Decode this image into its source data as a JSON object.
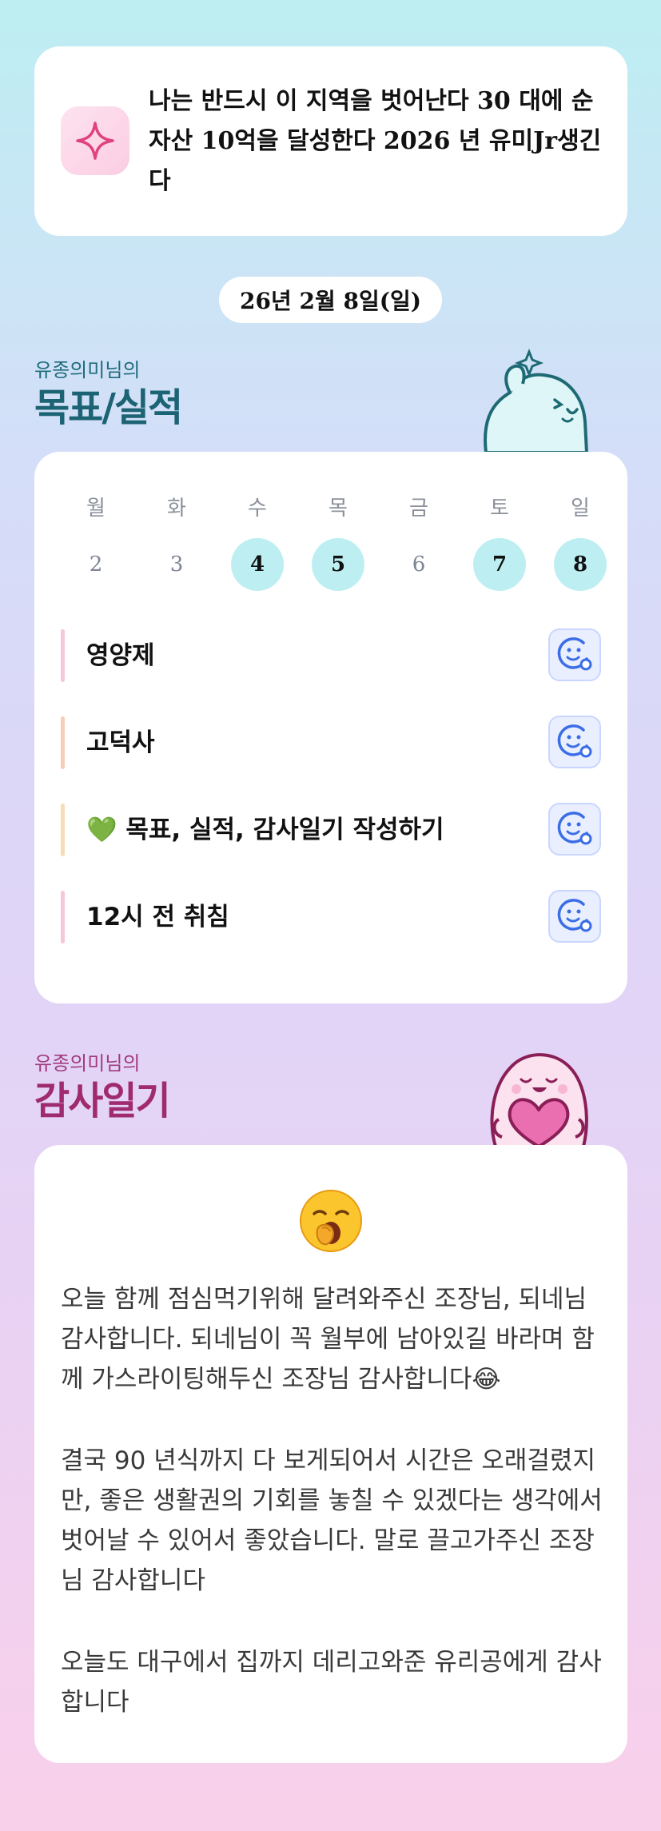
{
  "goal_banner": {
    "text": "나는 반드시 이 지역을 벗어난다 30 대에 순자산 10억을 달성한다 2026 년 유미Jr생긴다",
    "icon": "sparkle-icon"
  },
  "date": "26년 2월 8일(일)",
  "goals_section": {
    "subtitle": "유종의미님의",
    "title": "목표/실적",
    "weekdays": [
      "월",
      "화",
      "수",
      "목",
      "금",
      "토",
      "일"
    ],
    "days": [
      {
        "num": "2",
        "active": false
      },
      {
        "num": "3",
        "active": false
      },
      {
        "num": "4",
        "active": true
      },
      {
        "num": "5",
        "active": true
      },
      {
        "num": "6",
        "active": false
      },
      {
        "num": "7",
        "active": true
      },
      {
        "num": "8",
        "active": true
      }
    ],
    "items": [
      {
        "label": "영양제",
        "bar_color": "#f6c6dc"
      },
      {
        "label": "고덕사",
        "bar_color": "#f7cdb8"
      },
      {
        "label": "💚 목표, 실적, 감사일기 작성하기",
        "bar_color": "#f7ddb7"
      },
      {
        "label": "12시 전 취침",
        "bar_color": "#f6c6dc"
      }
    ],
    "reaction_icon": "smile-add-reaction-icon"
  },
  "gratitude_section": {
    "subtitle": "유종의미님의",
    "title": "감사일기",
    "emoji": "yawning-face-emoji",
    "paragraphs": [
      "오늘 함께 점심먹기위해 달려와주신 조장님, 되네님 감사합니다. 되네님이 꼭 월부에 남아있길 바라며 함께 가스라이팅해두신 조장님 감사합니다😂",
      "결국 90 년식까지 다 보게되어서 시간은 오래걸렸지만, 좋은 생활권의 기회를 놓칠 수 있겠다는 생각에서 벗어날 수 있어서 좋았습니다. 말로 끌고가주신 조장님 감사합니다",
      "오늘도 대구에서 집까지 데리고와준 유리공에게 감사합니다"
    ]
  },
  "colors": {
    "goals_title": "#1c6374",
    "gratitude_title": "#a02a6f",
    "active_day": "#bdeff2",
    "reaction_bg": "#e9efff"
  }
}
